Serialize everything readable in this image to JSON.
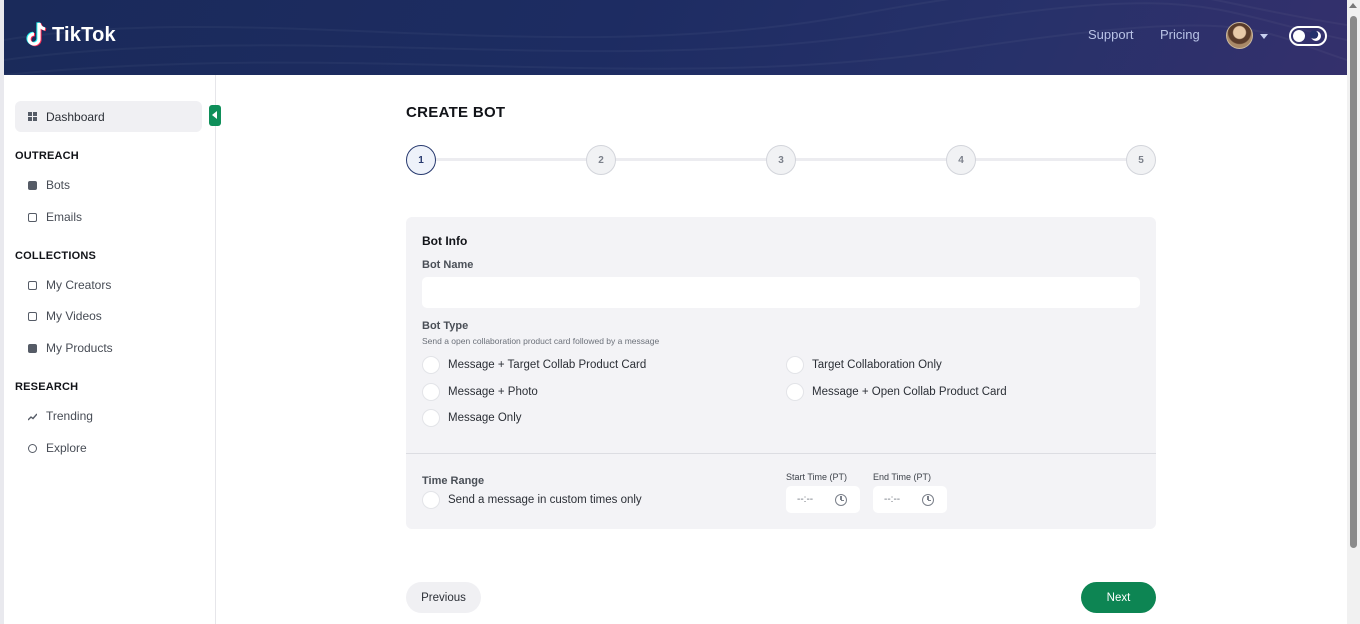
{
  "header": {
    "brand": "TikTok",
    "nav": {
      "support": "Support",
      "pricing": "Pricing"
    },
    "accent_color": "#1d2c62"
  },
  "sidebar": {
    "dashboard": "Dashboard",
    "sections": [
      {
        "title": "OUTREACH",
        "items": [
          {
            "label": "Bots",
            "icon": "robot-icon"
          },
          {
            "label": "Emails",
            "icon": "email-icon"
          }
        ]
      },
      {
        "title": "COLLECTIONS",
        "items": [
          {
            "label": "My Creators",
            "icon": "creators-icon"
          },
          {
            "label": "My Videos",
            "icon": "video-icon"
          },
          {
            "label": "My Products",
            "icon": "products-icon"
          }
        ]
      },
      {
        "title": "RESEARCH",
        "items": [
          {
            "label": "Trending",
            "icon": "trending-icon"
          },
          {
            "label": "Explore",
            "icon": "globe-icon"
          }
        ]
      }
    ]
  },
  "main": {
    "title": "CREATE BOT",
    "steps": [
      "1",
      "2",
      "3",
      "4",
      "5"
    ],
    "active_step": "1",
    "card": {
      "title": "Bot Info",
      "bot_name_label": "Bot Name",
      "bot_name_value": "",
      "bot_type_label": "Bot Type",
      "bot_type_help": "Send a open collaboration product card followed by a message",
      "bot_types": [
        "Message + Target Collab Product Card",
        "Message + Photo",
        "Message Only",
        "Target Collaboration Only",
        "Message + Open Collab Product Card"
      ],
      "time_range_label": "Time Range",
      "custom_times_label": "Send a message in custom times only",
      "start_time_label": "Start Time (PT)",
      "end_time_label": "End Time (PT)",
      "start_time_value": "--:--",
      "end_time_value": "--:--"
    },
    "buttons": {
      "previous": "Previous",
      "next": "Next"
    },
    "next_color": "#0d8553"
  }
}
